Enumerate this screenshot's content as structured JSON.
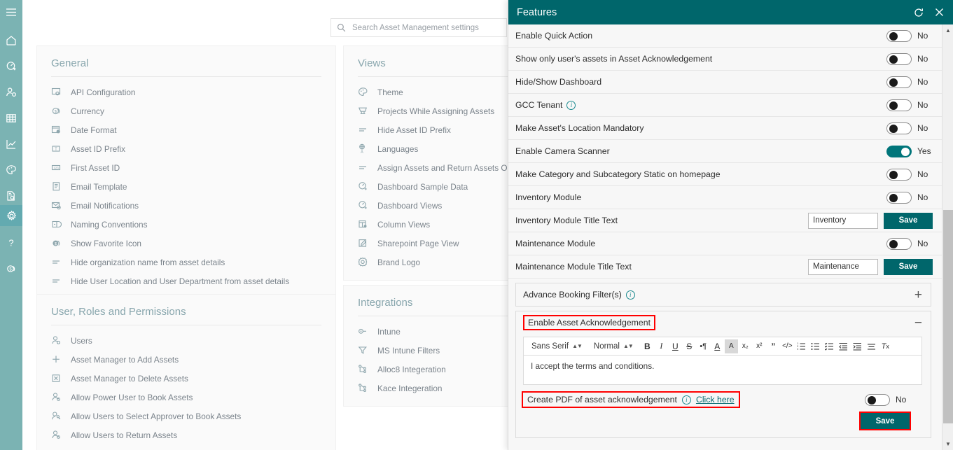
{
  "rail": {
    "items": [
      {
        "name": "menu-toggle",
        "icon": "hamburger-icon"
      },
      {
        "name": "home",
        "icon": "home-icon"
      },
      {
        "name": "dashboard-add",
        "icon": "gauge-plus-icon"
      },
      {
        "name": "user-settings",
        "icon": "user-gear-icon"
      },
      {
        "name": "table",
        "icon": "table-icon"
      },
      {
        "name": "reports",
        "icon": "line-chart-icon"
      },
      {
        "name": "theme",
        "icon": "palette-icon"
      },
      {
        "name": "document-search",
        "icon": "document-search-icon"
      },
      {
        "name": "settings",
        "icon": "gear-icon"
      },
      {
        "name": "help",
        "icon": "question-mark-icon"
      },
      {
        "name": "currency",
        "icon": "coins-icon"
      }
    ]
  },
  "search": {
    "placeholder": "Search Asset Management settings",
    "icon": "search-icon"
  },
  "general": {
    "title": "General",
    "items": [
      {
        "label": "API Configuration",
        "icon": "api-config-icon"
      },
      {
        "label": "Currency",
        "icon": "coins-icon"
      },
      {
        "label": "Date Format",
        "icon": "calendar-clock-icon"
      },
      {
        "label": "Asset ID Prefix",
        "icon": "text-box-icon"
      },
      {
        "label": "First Asset ID",
        "icon": "number-box-icon"
      },
      {
        "label": "Email Template",
        "icon": "document-lines-icon"
      },
      {
        "label": "Email Notifications",
        "icon": "envelope-gear-icon"
      },
      {
        "label": "Naming Conventions",
        "icon": "naming-icon"
      },
      {
        "label": "Show Favorite Icon",
        "icon": "coin-star-icon"
      },
      {
        "label": "Hide organization name from asset details",
        "icon": "lines-icon"
      },
      {
        "label": "Hide User Location and User Department from asset details",
        "icon": "lines-icon"
      }
    ]
  },
  "user_roles": {
    "title": "User, Roles and Permissions",
    "items": [
      {
        "label": "Users",
        "icon": "user-plus-icon"
      },
      {
        "label": "Asset Manager to Add Assets",
        "icon": "plus-icon"
      },
      {
        "label": "Asset Manager to Delete Assets",
        "icon": "x-box-icon"
      },
      {
        "label": "Allow Power User to Book Assets",
        "icon": "user-check-icon"
      },
      {
        "label": "Allow Users to Select Approver to Book Assets",
        "icon": "user-key-icon"
      },
      {
        "label": "Allow Users to Return Assets",
        "icon": "user-check-icon"
      }
    ]
  },
  "views": {
    "title": "Views",
    "items": [
      {
        "label": "Theme",
        "icon": "palette-icon"
      },
      {
        "label": "Projects While Assigning Assets",
        "icon": "cart-icon"
      },
      {
        "label": "Hide Asset ID Prefix",
        "icon": "lines-icon"
      },
      {
        "label": "Languages",
        "icon": "globe-language-icon"
      },
      {
        "label": "Assign Assets and Return Assets Options",
        "icon": "lines-icon"
      },
      {
        "label": "Dashboard Sample Data",
        "icon": "gauge-plus-icon"
      },
      {
        "label": "Dashboard Views",
        "icon": "gauge-plus-icon"
      },
      {
        "label": "Column Views",
        "icon": "column-gear-icon"
      },
      {
        "label": "Sharepoint Page View",
        "icon": "edit-page-icon"
      },
      {
        "label": "Brand Logo",
        "icon": "badge-icon"
      }
    ]
  },
  "integrations": {
    "title": "Integrations",
    "items": [
      {
        "label": "Intune",
        "icon": "plug-icon"
      },
      {
        "label": "MS Intune Filters",
        "icon": "funnel-icon"
      },
      {
        "label": "Alloc8 Integeration",
        "icon": "node-graph-icon"
      },
      {
        "label": "Kace Integeration",
        "icon": "node-graph-icon"
      }
    ]
  },
  "panel": {
    "title": "Features",
    "refresh_icon": "refresh-icon",
    "close_icon": "close-icon",
    "accent_color": "#00666b",
    "rows": [
      {
        "label": "Enable Quick Action",
        "type": "toggle",
        "state": "No",
        "on": false
      },
      {
        "label": "Show only user's assets in Asset Acknowledgement",
        "type": "toggle",
        "state": "No",
        "on": false
      },
      {
        "label": "Hide/Show Dashboard",
        "type": "toggle",
        "state": "No",
        "on": false
      },
      {
        "label": "GCC Tenant",
        "type": "toggle",
        "state": "No",
        "on": false,
        "info": true
      },
      {
        "label": "Make Asset's Location Mandatory",
        "type": "toggle",
        "state": "No",
        "on": false
      },
      {
        "label": "Enable Camera Scanner",
        "type": "toggle",
        "state": "Yes",
        "on": true
      },
      {
        "label": "Make Category and Subcategory Static on homepage",
        "type": "toggle",
        "state": "No",
        "on": false
      },
      {
        "label": "Inventory Module",
        "type": "toggle",
        "state": "No",
        "on": false
      },
      {
        "label": "Inventory Module Title Text",
        "type": "text",
        "value": "Inventory",
        "button": "Save"
      },
      {
        "label": "Maintenance Module",
        "type": "toggle",
        "state": "No",
        "on": false
      },
      {
        "label": "Maintenance Module Title Text",
        "type": "text",
        "value": "Maintenance",
        "button": "Save"
      }
    ],
    "advance_booking": {
      "label": "Advance Booking Filter(s)",
      "sign": "+",
      "info": true
    },
    "asset_ack": {
      "label": "Enable Asset Acknowledgement",
      "sign": "−",
      "highlighted": true,
      "editor": {
        "font_family": "Sans Serif",
        "font_size": "Normal",
        "content": "I accept the terms and conditions.",
        "tools": [
          {
            "name": "bold-icon",
            "glyph": "B"
          },
          {
            "name": "italic-icon",
            "glyph": "I"
          },
          {
            "name": "underline-icon",
            "glyph": "U"
          },
          {
            "name": "strikethrough-icon",
            "glyph": "S"
          },
          {
            "name": "text-direction-icon",
            "glyph": "¶"
          },
          {
            "name": "font-color-icon",
            "glyph": "A"
          },
          {
            "name": "highlight-color-icon",
            "glyph": "A"
          },
          {
            "name": "subscript-icon",
            "glyph": "x₂"
          },
          {
            "name": "superscript-icon",
            "glyph": "x²"
          },
          {
            "name": "blockquote-icon",
            "glyph": "”"
          },
          {
            "name": "code-block-icon",
            "glyph": "‹›"
          },
          {
            "name": "ordered-list-icon",
            "glyph": "≡"
          },
          {
            "name": "bullet-list-icon",
            "glyph": "≡"
          },
          {
            "name": "check-list-icon",
            "glyph": "≡"
          },
          {
            "name": "outdent-icon",
            "glyph": "≡"
          },
          {
            "name": "indent-icon",
            "glyph": "≡"
          },
          {
            "name": "align-icon",
            "glyph": "≡"
          },
          {
            "name": "clear-format-icon",
            "glyph": "Tₓ"
          }
        ]
      },
      "pdf_row": {
        "label": "Create PDF of asset acknowledgement",
        "link": "Click here",
        "state": "No",
        "on": false,
        "highlighted": true
      },
      "save_label": "Save",
      "save_highlighted": true
    }
  }
}
